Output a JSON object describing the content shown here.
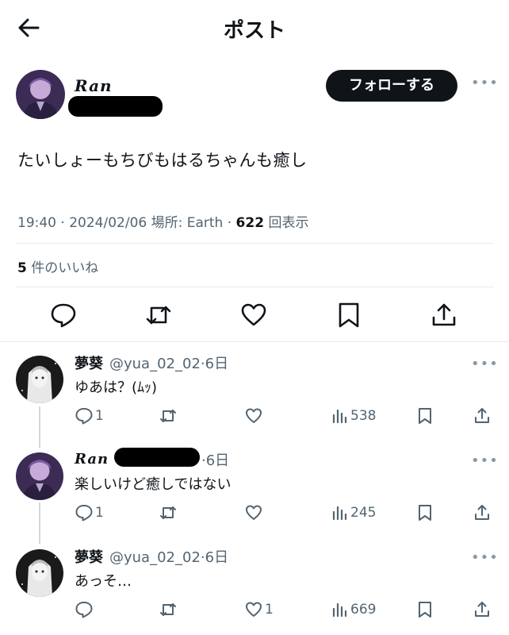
{
  "header": {
    "title": "ポスト"
  },
  "post": {
    "display_name": "Ran",
    "follow_label": "フォローする",
    "more": "•••",
    "text": "たいしょーもちびもはるちゃんも癒し",
    "time": "19:40",
    "sep1": " · ",
    "date": "2024/02/06",
    "location": " 場所: Earth",
    "sep2": " · ",
    "views": "622",
    "views_label": " 回表示",
    "likes_count": "5",
    "likes_label": " 件のいいね"
  },
  "replies": [
    {
      "name": "夢葵",
      "handle": "@yua_02_02",
      "age": "·6日",
      "text": "ゆあは？(ﾑｯ)",
      "reply_count": "1",
      "retweet_count": "",
      "like_count": "",
      "views": "538",
      "more": "•••"
    },
    {
      "name": "Ran",
      "handle": "",
      "age": "·6日",
      "text": "楽しいけど癒しではない",
      "reply_count": "1",
      "retweet_count": "",
      "like_count": "",
      "views": "245",
      "more": "•••"
    },
    {
      "name": "夢葵",
      "handle": "@yua_02_02",
      "age": "·6日",
      "text": "あっそ…",
      "reply_count": "",
      "retweet_count": "",
      "like_count": "1",
      "views": "669",
      "more": "•••"
    }
  ],
  "icons": [
    "back-arrow-icon",
    "reply-icon",
    "retweet-icon",
    "like-icon",
    "bookmark-icon",
    "share-icon",
    "views-icon",
    "more-icon"
  ]
}
